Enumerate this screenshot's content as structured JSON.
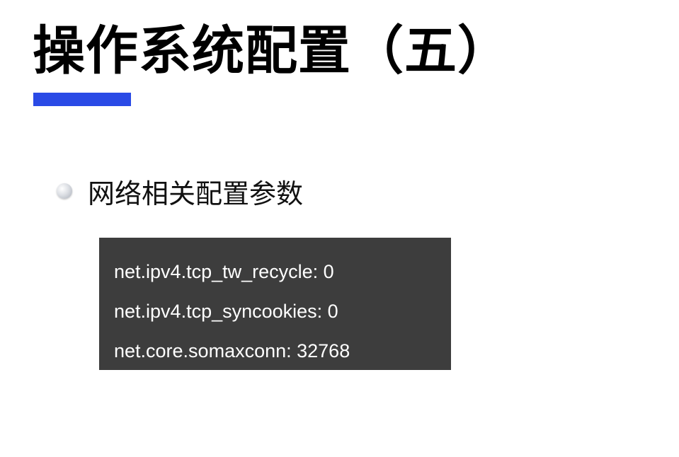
{
  "slide": {
    "title": "操作系统配置（五）",
    "accent_color": "#2a4ae6"
  },
  "bullet": {
    "text": "网络相关配置参数",
    "icon": "bullet-dot-icon"
  },
  "code_block": {
    "background": "#3d3d3d",
    "lines": [
      "net.ipv4.tcp_tw_recycle: 0",
      "net.ipv4.tcp_syncookies: 0",
      "net.core.somaxconn: 32768"
    ]
  }
}
